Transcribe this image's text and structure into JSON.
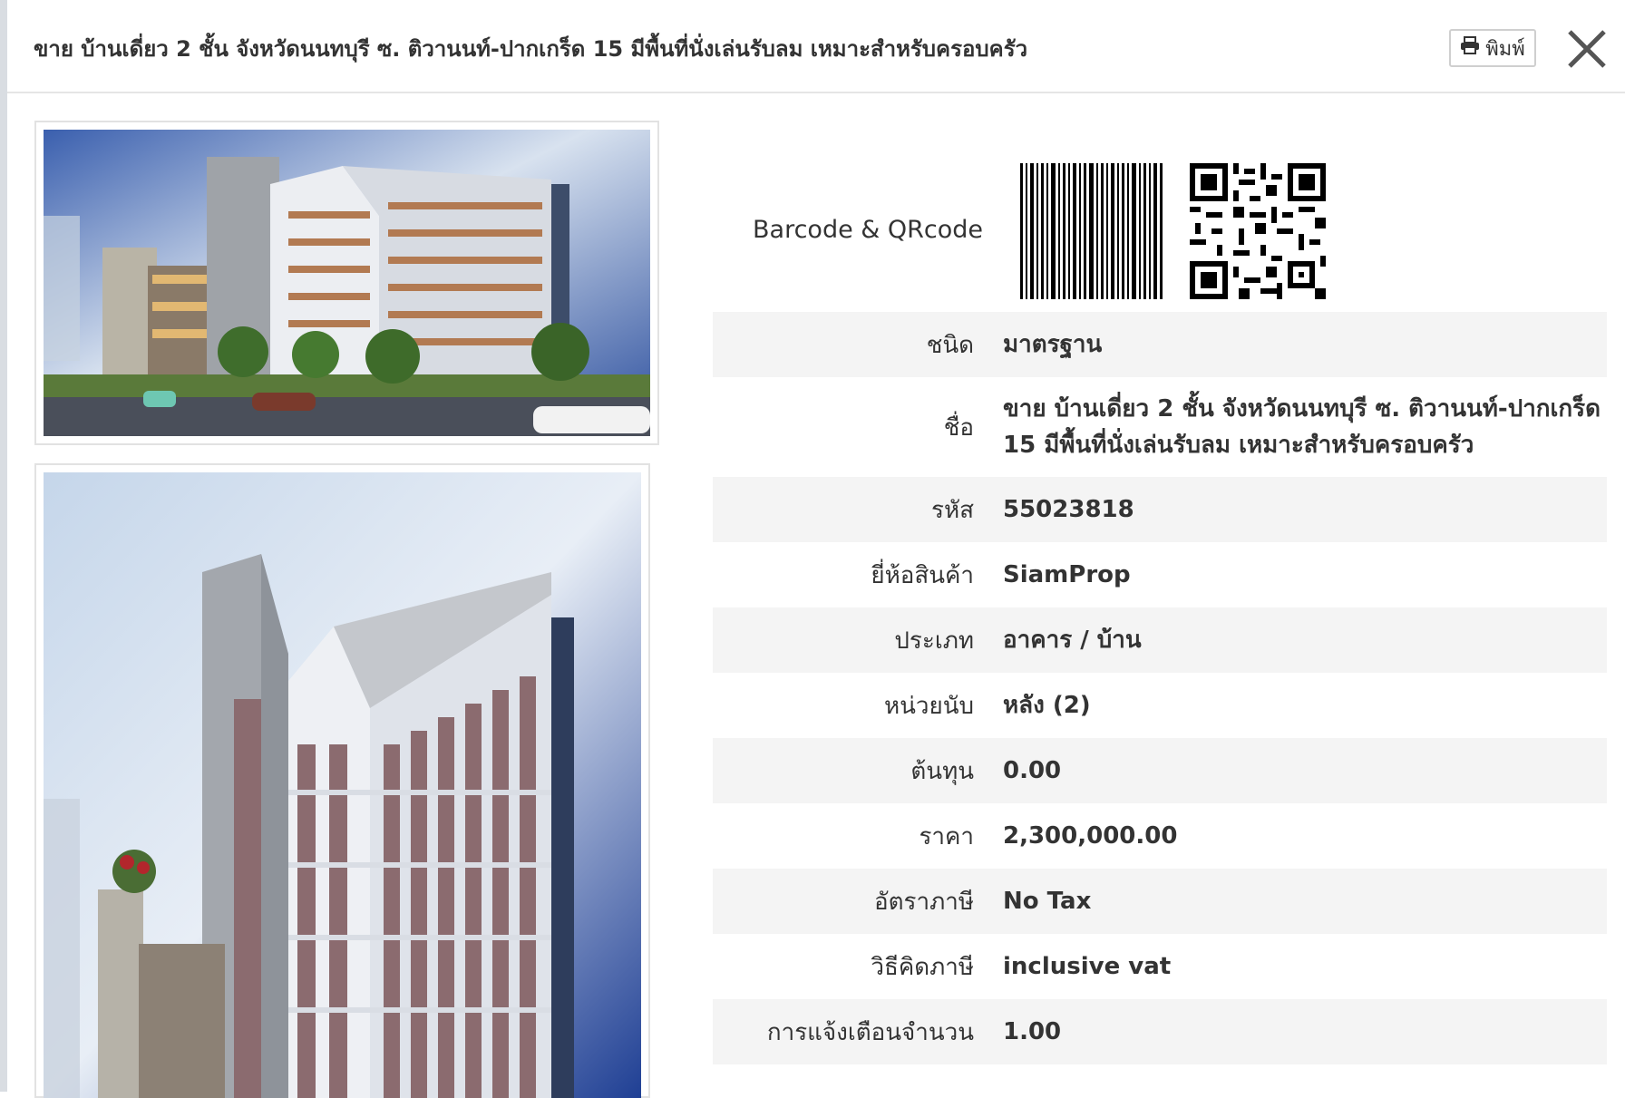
{
  "header": {
    "title": "ขาย บ้านเดี่ยว 2 ชั้น จังหวัดนนทบุรี ซ. ติวานนท์-ปากเกร็ด 15 มีพื้นที่นั่งเล่นรับลม เหมาะสำหรับครอบครัว",
    "print_label": "พิมพ์",
    "print_icon": "printer-icon",
    "close_icon": "close-icon"
  },
  "codes": {
    "label": "Barcode & QRcode"
  },
  "details": [
    {
      "label": "ชนิด",
      "value": "มาตรฐาน"
    },
    {
      "label": "ชื่อ",
      "value": "ขาย บ้านเดี่ยว 2 ชั้น จังหวัดนนทบุรี ซ. ติวานนท์-ปากเกร็ด 15 มีพื้นที่นั่งเล่นรับลม เหมาะสำหรับครอบครัว"
    },
    {
      "label": "รหัส",
      "value": "55023818"
    },
    {
      "label": "ยี่ห้อสินค้า",
      "value": "SiamProp"
    },
    {
      "label": "ประเภท",
      "value": "อาคาร / บ้าน"
    },
    {
      "label": "หน่วยนับ",
      "value": "หลัง (2)"
    },
    {
      "label": "ต้นทุน",
      "value": "0.00"
    },
    {
      "label": "ราคา",
      "value": "2,300,000.00"
    },
    {
      "label": "อัตราภาษี",
      "value": "No Tax"
    },
    {
      "label": "วิธีคิดภาษี",
      "value": "inclusive vat"
    },
    {
      "label": "การแจ้งเตือนจำนวน",
      "value": "1.00"
    }
  ]
}
